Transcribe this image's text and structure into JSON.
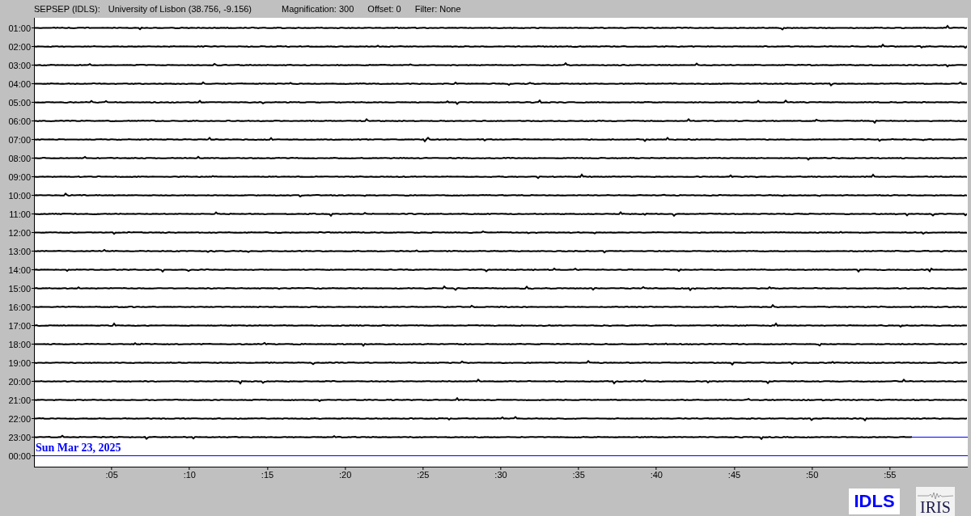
{
  "header": {
    "station": "SEPSEP (IDLS):",
    "location": "University of Lisbon (38.756, -9.156)",
    "magnification": "Magnification: 300",
    "offset": "Offset: 0",
    "filter": "Filter: None"
  },
  "rows": [
    {
      "time": "01:00",
      "level": 1
    },
    {
      "time": "02:00",
      "level": 1
    },
    {
      "time": "03:00",
      "level": 1
    },
    {
      "time": "04:00",
      "level": 1
    },
    {
      "time": "05:00",
      "level": 1
    },
    {
      "time": "06:00",
      "level": 1
    },
    {
      "time": "07:00",
      "level": 1
    },
    {
      "time": "08:00",
      "level": 1
    },
    {
      "time": "09:00",
      "level": 1
    },
    {
      "time": "10:00",
      "level": 1
    },
    {
      "time": "11:00",
      "level": 1
    },
    {
      "time": "12:00",
      "level": 1
    },
    {
      "time": "13:00",
      "level": 1
    },
    {
      "time": "14:00",
      "level": 1
    },
    {
      "time": "15:00",
      "level": 1
    },
    {
      "time": "16:00",
      "level": 1
    },
    {
      "time": "17:00",
      "level": 1
    },
    {
      "time": "18:00",
      "level": 1
    },
    {
      "time": "19:00",
      "level": 1
    },
    {
      "time": "20:00",
      "level": 1
    },
    {
      "time": "21:00",
      "level": 1
    },
    {
      "time": "22:00",
      "level": 1
    },
    {
      "time": "23:00",
      "level": 0.94
    },
    {
      "time": "00:00"
    }
  ],
  "date_label": "Sun Mar 23, 2025",
  "x_ticks": [
    ":05",
    ":10",
    ":15",
    ":20",
    ":25",
    ":30",
    ":35",
    ":40",
    ":45",
    ":50",
    ":55"
  ],
  "logos": [
    {
      "kind": "text",
      "text": "IDLS"
    },
    {
      "kind": "iris",
      "text": "IRIS"
    }
  ]
}
